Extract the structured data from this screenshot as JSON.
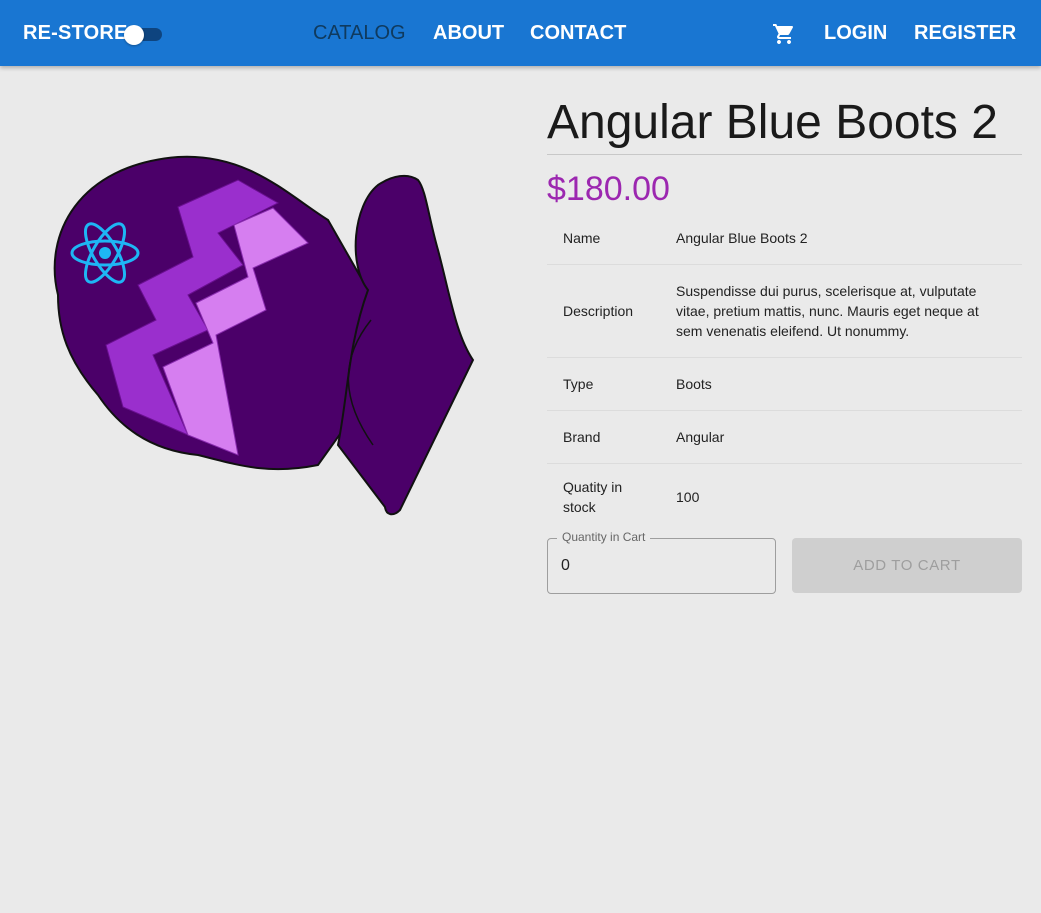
{
  "appbar": {
    "brand": "RE-STORE",
    "nav": [
      {
        "label": "CATALOG",
        "active": true
      },
      {
        "label": "ABOUT",
        "active": false
      },
      {
        "label": "CONTACT",
        "active": false
      }
    ],
    "login": "LOGIN",
    "register": "REGISTER",
    "cart_icon": "shopping-cart-icon",
    "theme_toggle_on": false,
    "color": "#1976d2"
  },
  "product": {
    "title": "Angular Blue Boots 2",
    "price": "$180.00",
    "price_color": "#9c27b0",
    "image": "purple-mitten-with-react-logo",
    "details": [
      {
        "key": "Name",
        "value": "Angular Blue Boots 2"
      },
      {
        "key": "Description",
        "value": "Suspendisse dui purus, scelerisque at, vulputate vitae, pretium mattis, nunc. Mauris eget neque at sem venenatis eleifend. Ut nonummy."
      },
      {
        "key": "Type",
        "value": "Boots"
      },
      {
        "key": "Brand",
        "value": "Angular"
      },
      {
        "key": "Quatity in stock",
        "value": "100"
      }
    ]
  },
  "cart": {
    "quantity_label": "Quantity in Cart",
    "quantity_value": "0",
    "add_button": "ADD TO CART"
  }
}
